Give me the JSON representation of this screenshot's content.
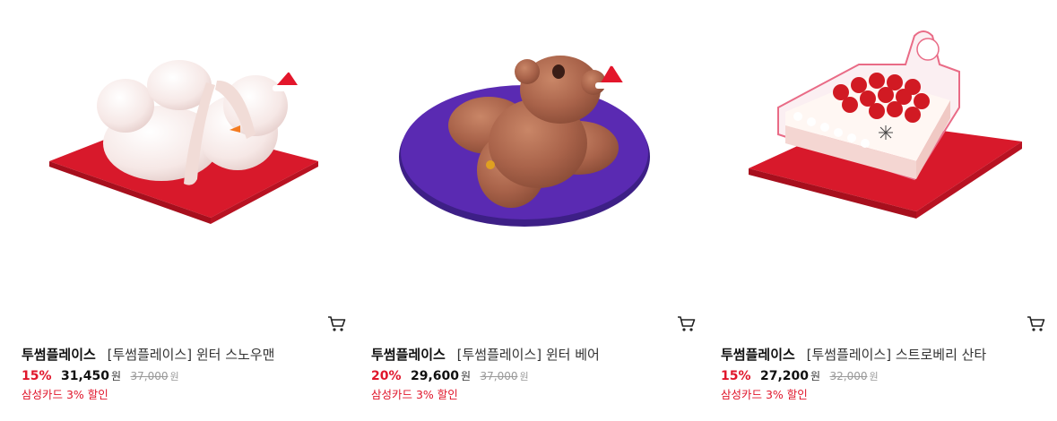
{
  "products": [
    {
      "image_alt": "snowman cake",
      "brand": "투썸플레이스",
      "name": "[투썸플레이스] 윈터 스노우맨",
      "discount": "15%",
      "sale_price": "31,450",
      "currency": "원",
      "original_price": "37,000",
      "promo": "삼성카드 3% 할인",
      "cart_icon": "cart-icon"
    },
    {
      "image_alt": "bear cake",
      "brand": "투썸플레이스",
      "name": "[투썸플레이스] 윈터 베어",
      "discount": "20%",
      "sale_price": "29,600",
      "currency": "원",
      "original_price": "37,000",
      "promo": "삼성카드 3% 할인",
      "cart_icon": "cart-icon"
    },
    {
      "image_alt": "strawberry santa cake",
      "brand": "투썸플레이스",
      "name": "[투썸플레이스] 스트로베리 산타",
      "discount": "15%",
      "sale_price": "27,200",
      "currency": "원",
      "original_price": "32,000",
      "promo": "삼성카드 3% 할인",
      "cart_icon": "cart-icon"
    }
  ],
  "colors": {
    "discount": "#e0162b",
    "promo": "#e0162b",
    "strike": "#999999"
  }
}
